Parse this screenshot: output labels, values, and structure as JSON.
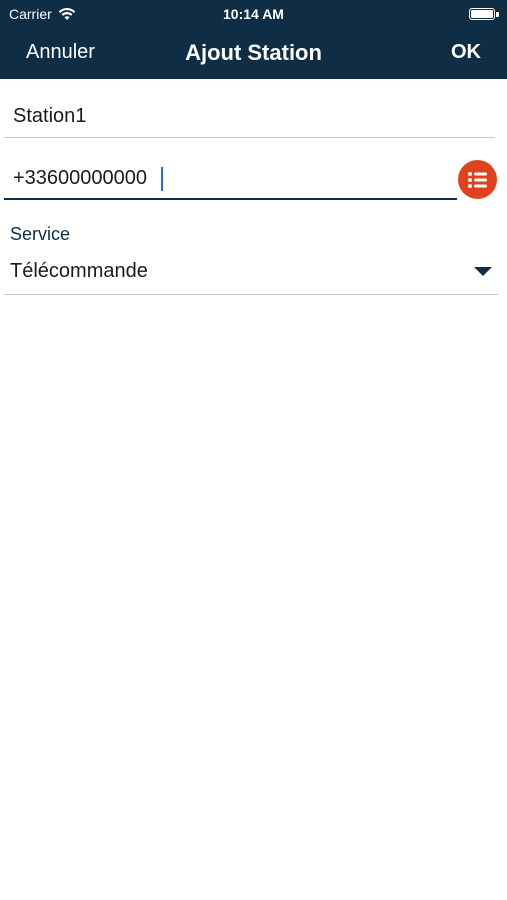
{
  "status_bar": {
    "carrier": "Carrier",
    "time": "10:14 AM",
    "wifi_icon": "wifi-icon",
    "battery_icon": "battery-icon"
  },
  "nav": {
    "cancel_label": "Annuler",
    "title": "Ajout Station",
    "ok_label": "OK",
    "background_color": "#0f2d45"
  },
  "form": {
    "station_name": {
      "value": "Station1"
    },
    "phone": {
      "value": "+33600000000",
      "contacts_icon": "list-icon",
      "button_color": "#e1411d"
    },
    "service": {
      "label": "Service",
      "value": "Télécommande",
      "arrow_icon": "chevron-down-icon"
    }
  }
}
